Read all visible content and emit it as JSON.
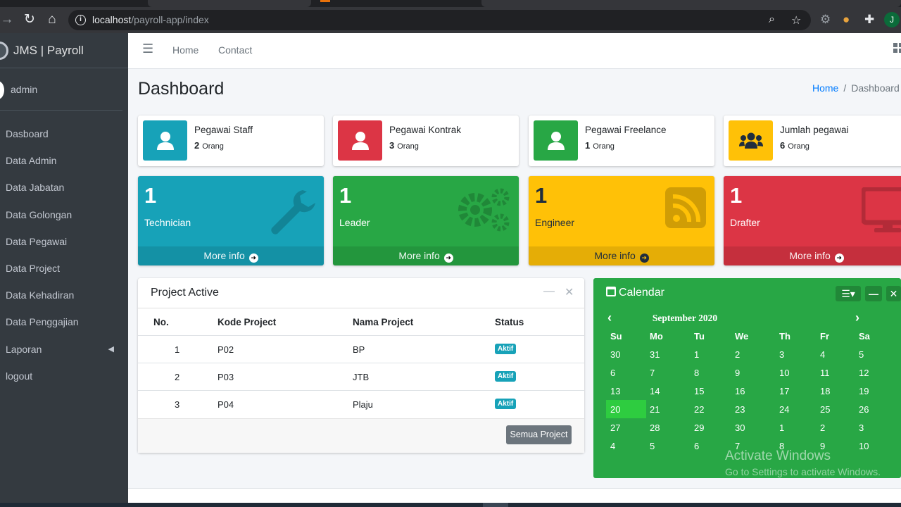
{
  "browser": {
    "url_host": "localhost",
    "url_path": "/payroll-app/index",
    "profile_initial": "J"
  },
  "sidebar": {
    "brand": "JMS | Payroll",
    "user": "admin",
    "items": [
      {
        "label": "Dasboard"
      },
      {
        "label": "Data Admin"
      },
      {
        "label": "Data Jabatan"
      },
      {
        "label": "Data Golongan"
      },
      {
        "label": "Data Pegawai"
      },
      {
        "label": "Data Project"
      },
      {
        "label": "Data Kehadiran"
      },
      {
        "label": "Data Penggajian"
      },
      {
        "label": "Laporan"
      },
      {
        "label": "logout"
      }
    ]
  },
  "topnav": {
    "home": "Home",
    "contact": "Contact"
  },
  "header": {
    "title": "Dashboard",
    "crumb_home": "Home",
    "crumb_sep": "/",
    "crumb_current": "Dashboard v"
  },
  "info_boxes": [
    {
      "label": "Pegawai Staff",
      "value": "2",
      "unit": "Orang",
      "color": "#17a2b8",
      "icon": "user-icon"
    },
    {
      "label": "Pegawai Kontrak",
      "value": "3",
      "unit": "Orang",
      "color": "#dc3545",
      "icon": "user-icon"
    },
    {
      "label": "Pegawai Freelance",
      "value": "1",
      "unit": "Orang",
      "color": "#28a745",
      "icon": "user-icon"
    },
    {
      "label": "Jumlah pegawai",
      "value": "6",
      "unit": "Orang",
      "color": "#ffc107",
      "icon": "users-icon"
    }
  ],
  "small_boxes": [
    {
      "number": "1",
      "label": "Technician",
      "footer": "More info",
      "color": "#17a2b8",
      "icon": "wrench-icon"
    },
    {
      "number": "1",
      "label": "Leader",
      "footer": "More info",
      "color": "#28a745",
      "icon": "cogs-icon"
    },
    {
      "number": "1",
      "label": "Engineer",
      "footer": "More info",
      "color": "#ffc107",
      "icon": "rss-icon"
    },
    {
      "number": "1",
      "label": "Drafter",
      "footer": "More info",
      "color": "#dc3545",
      "icon": "desktop-icon"
    }
  ],
  "projects": {
    "title": "Project Active",
    "columns": [
      "No.",
      "Kode Project",
      "Nama Project",
      "Status"
    ],
    "rows": [
      {
        "no": "1",
        "kode": "P02",
        "nama": "BP",
        "status": "Aktif"
      },
      {
        "no": "2",
        "kode": "P03",
        "nama": "JTB",
        "status": "Aktif"
      },
      {
        "no": "3",
        "kode": "P04",
        "nama": "Plaju",
        "status": "Aktif"
      }
    ],
    "button": "Semua Project"
  },
  "calendar": {
    "title": "Calendar",
    "month": "September 2020",
    "weekdays": [
      "Su",
      "Mo",
      "Tu",
      "We",
      "Th",
      "Fr",
      "Sa"
    ],
    "weeks": [
      [
        "30",
        "31",
        "1",
        "2",
        "3",
        "4",
        "5"
      ],
      [
        "6",
        "7",
        "8",
        "9",
        "10",
        "11",
        "12"
      ],
      [
        "13",
        "14",
        "15",
        "16",
        "17",
        "18",
        "19"
      ],
      [
        "20",
        "21",
        "22",
        "23",
        "24",
        "25",
        "26"
      ],
      [
        "27",
        "28",
        "29",
        "30",
        "1",
        "2",
        "3"
      ],
      [
        "4",
        "5",
        "6",
        "7",
        "8",
        "9",
        "10"
      ]
    ],
    "today": "20"
  },
  "watermark": {
    "line1": "Activate Windows",
    "line2": "Go to Settings to activate Windows."
  }
}
